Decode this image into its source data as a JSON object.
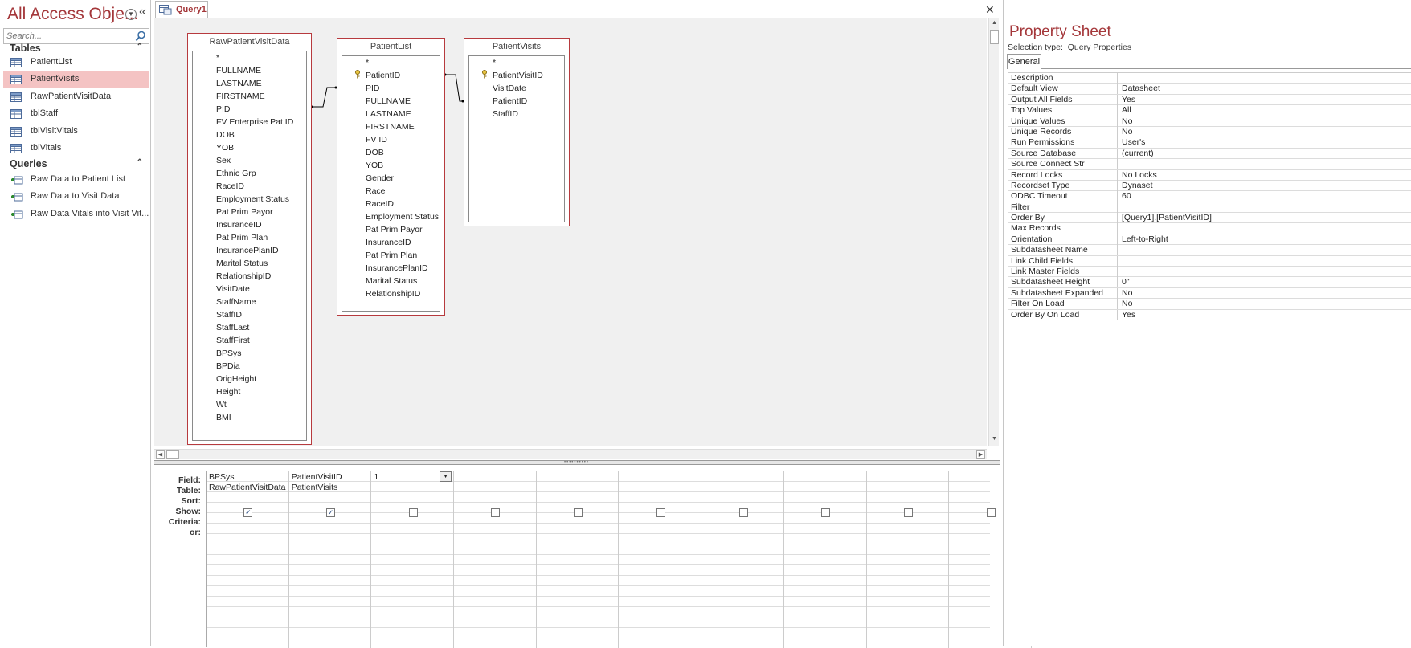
{
  "nav": {
    "title": "All Access Obje...",
    "search_placeholder": "Search...",
    "tables_header": "Tables",
    "tables": [
      "PatientList",
      "PatientVisits",
      "RawPatientVisitData",
      "tblStaff",
      "tblVisitVitals",
      "tblVitals"
    ],
    "selected_table": "PatientVisits",
    "queries_header": "Queries",
    "queries": [
      "Raw Data to Patient List",
      "Raw Data to Visit Data",
      "Raw Data Vitals into Visit Vit..."
    ]
  },
  "tab": {
    "label": "Query1"
  },
  "tables": [
    {
      "name": "RawPatientVisitData",
      "fields": [
        "*",
        "FULLNAME",
        "LASTNAME",
        "FIRSTNAME",
        "PID",
        "FV Enterprise Pat ID",
        "DOB",
        "YOB",
        "Sex",
        "Ethnic Grp",
        "RaceID",
        "Employment Status",
        "Pat Prim Payor",
        "InsuranceID",
        "Pat Prim Plan",
        "InsurancePlanID",
        "Marital Status",
        "RelationshipID",
        "VisitDate",
        "StaffName",
        "StaffID",
        "StaffLast",
        "StaffFirst",
        "BPSys",
        "BPDia",
        "OrigHeight",
        "Height",
        "Wt",
        "BMI"
      ]
    },
    {
      "name": "PatientList",
      "key": "PatientID",
      "fields": [
        "*",
        "PatientID",
        "PID",
        "FULLNAME",
        "LASTNAME",
        "FIRSTNAME",
        "FV ID",
        "DOB",
        "YOB",
        "Gender",
        "Race",
        "RaceID",
        "Employment Status",
        "Pat Prim Payor",
        "InsuranceID",
        "Pat Prim Plan",
        "InsurancePlanID",
        "Marital Status",
        "RelationshipID"
      ]
    },
    {
      "name": "PatientVisits",
      "key": "PatientVisitID",
      "fields": [
        "*",
        "PatientVisitID",
        "VisitDate",
        "PatientID",
        "StaffID"
      ]
    }
  ],
  "qbe": {
    "row_labels": [
      "Field:",
      "Table:",
      "Sort:",
      "Show:",
      "Criteria:",
      "or:"
    ],
    "columns": [
      {
        "field": "BPSys",
        "table": "RawPatientVisitData",
        "show": true
      },
      {
        "field": "PatientVisitID",
        "table": "PatientVisits",
        "show": true
      },
      {
        "field": "1",
        "table": "",
        "show": false
      },
      {
        "field": "",
        "table": "",
        "show": false
      },
      {
        "field": "",
        "table": "",
        "show": false
      },
      {
        "field": "",
        "table": "",
        "show": false
      },
      {
        "field": "",
        "table": "",
        "show": false
      },
      {
        "field": "",
        "table": "",
        "show": false
      },
      {
        "field": "",
        "table": "",
        "show": false
      },
      {
        "field": "",
        "table": "",
        "show": false
      }
    ]
  },
  "property_sheet": {
    "title": "Property Sheet",
    "selection_label": "Selection type:",
    "selection_type": "Query Properties",
    "tab": "General",
    "properties": [
      [
        "Description",
        ""
      ],
      [
        "Default View",
        "Datasheet"
      ],
      [
        "Output All Fields",
        "Yes"
      ],
      [
        "Top Values",
        "All"
      ],
      [
        "Unique Values",
        "No"
      ],
      [
        "Unique Records",
        "No"
      ],
      [
        "Run Permissions",
        "User's"
      ],
      [
        "Source Database",
        "(current)"
      ],
      [
        "Source Connect Str",
        ""
      ],
      [
        "Record Locks",
        "No Locks"
      ],
      [
        "Recordset Type",
        "Dynaset"
      ],
      [
        "ODBC Timeout",
        "60"
      ],
      [
        "Filter",
        ""
      ],
      [
        "Order By",
        "[Query1].[PatientVisitID]"
      ],
      [
        "Max Records",
        ""
      ],
      [
        "Orientation",
        "Left-to-Right"
      ],
      [
        "Subdatasheet Name",
        ""
      ],
      [
        "Link Child Fields",
        ""
      ],
      [
        "Link Master Fields",
        ""
      ],
      [
        "Subdatasheet Height",
        "0\""
      ],
      [
        "Subdatasheet Expanded",
        "No"
      ],
      [
        "Filter On Load",
        "No"
      ],
      [
        "Order By On Load",
        "Yes"
      ]
    ]
  }
}
